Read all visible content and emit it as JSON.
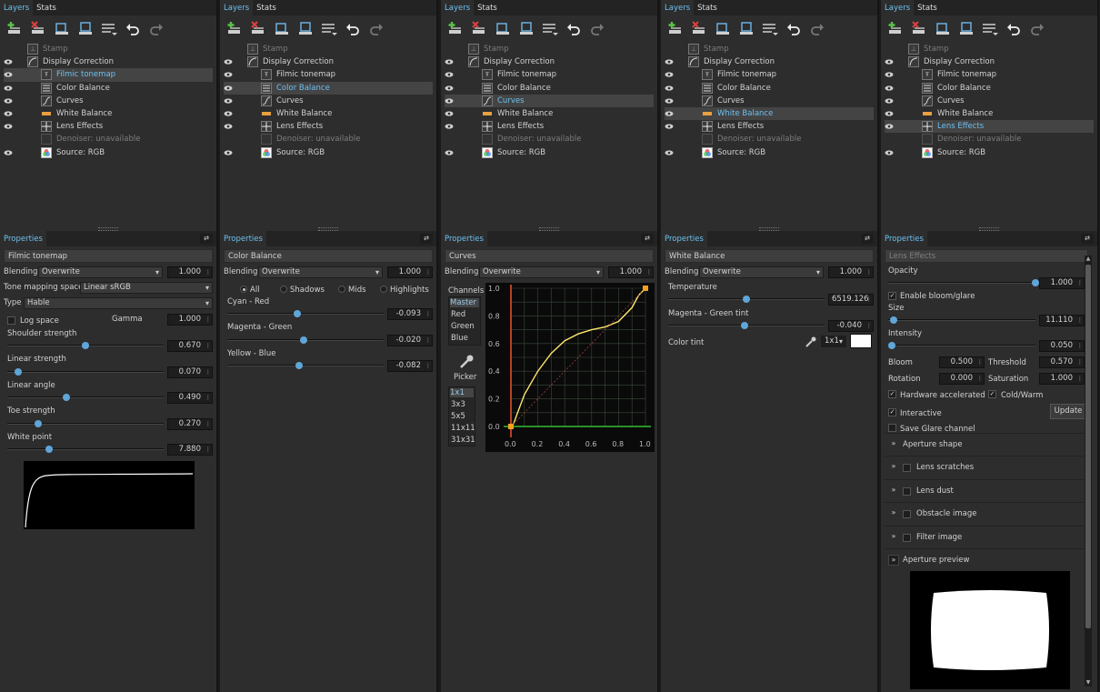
{
  "tabs": {
    "layers": "Layers",
    "stats": "Stats",
    "properties": "Properties"
  },
  "layers": {
    "stamp": "Stamp",
    "display_correction": "Display Correction",
    "filmic": "Filmic tonemap",
    "color_balance": "Color Balance",
    "curves": "Curves",
    "white_balance": "White Balance",
    "lens_effects": "Lens Effects",
    "denoiser": "Denoiser: unavailable",
    "source": "Source: RGB"
  },
  "common": {
    "blending_label": "Blending",
    "blending_value": "Overwrite",
    "opacity_value": "1.000"
  },
  "panel1": {
    "selected": "Filmic tonemap",
    "layer_name": "Filmic tonemap",
    "tone_mapping_label": "Tone mapping space",
    "tone_mapping_value": "Linear sRGB",
    "type_label": "Type",
    "type_value": "Hable",
    "log_space_label": "Log space",
    "gamma_label": "Gamma",
    "gamma_value": "1.000",
    "shoulder_label": "Shoulder strength",
    "shoulder_value": "0.670",
    "shoulder_level": 0.5,
    "linear_strength_label": "Linear strength",
    "linear_strength_value": "0.070",
    "linear_strength_level": 0.07,
    "linear_angle_label": "Linear angle",
    "linear_angle_value": "0.490",
    "linear_angle_level": 0.38,
    "toe_strength_label": "Toe strength",
    "toe_strength_value": "0.270",
    "toe_strength_level": 0.2,
    "white_point_label": "White point",
    "white_point_value": "7.880",
    "white_point_level": 0.27
  },
  "panel2": {
    "selected": "Color Balance",
    "layer_name": "Color Balance",
    "range_all": "All",
    "range_shadows": "Shadows",
    "range_mids": "Mids",
    "range_highlights": "Highlights",
    "cyan_red_label": "Cyan - Red",
    "cyan_red_value": "-0.093",
    "cyan_red_level": 0.45,
    "magenta_green_label": "Magenta - Green",
    "magenta_green_value": "-0.020",
    "magenta_green_level": 0.49,
    "yellow_blue_label": "Yellow - Blue",
    "yellow_blue_value": "-0.082",
    "yellow_blue_level": 0.46
  },
  "panel3": {
    "selected": "Curves",
    "layer_name": "Curves",
    "channels_label": "Channels",
    "channels": [
      "Master",
      "Red",
      "Green",
      "Blue"
    ],
    "picker_label": "Picker",
    "picker_sizes": [
      "1x1",
      "3x3",
      "5x5",
      "11x11",
      "31x31"
    ],
    "chart_data": {
      "type": "line",
      "x_ticks": [
        "0.0",
        "0.2",
        "0.4",
        "0.6",
        "0.8",
        "1.0"
      ],
      "y_ticks": [
        "0.0",
        "0.2",
        "0.4",
        "0.6",
        "0.8",
        "1.0"
      ],
      "xlim": [
        0,
        1
      ],
      "ylim": [
        0,
        1
      ],
      "grid": true,
      "series": [
        {
          "color": "#ffe66b",
          "x": [
            0.0,
            0.02,
            0.05,
            0.1,
            0.2,
            0.3,
            0.4,
            0.5,
            0.6,
            0.7,
            0.8,
            0.9,
            0.95,
            1.0
          ],
          "y": [
            0.0,
            0.02,
            0.1,
            0.23,
            0.4,
            0.53,
            0.62,
            0.67,
            0.7,
            0.72,
            0.76,
            0.86,
            0.95,
            1.0
          ]
        },
        {
          "color": "#a04040",
          "x": [
            0,
            1
          ],
          "y": [
            0,
            1
          ]
        }
      ]
    }
  },
  "panel4": {
    "selected": "White Balance",
    "layer_name": "White Balance",
    "temperature_label": "Temperature",
    "temperature_value": "6519.126",
    "temperature_level": 0.5,
    "tint_label": "Magenta - Green tint",
    "tint_value": "-0.040",
    "tint_level": 0.49,
    "color_tint_label": "Color tint",
    "color_tint_size": "1x1"
  },
  "panel5": {
    "selected": "Lens Effects",
    "layer_name": "Lens Effects",
    "opacity_label": "Opacity",
    "opacity_value": "1.000",
    "opacity_level": 1.0,
    "enable_bloom_label": "Enable bloom/glare",
    "size_label": "Size",
    "size_value": "11.110",
    "size_level": 0.0,
    "intensity_label": "Intensity",
    "intensity_value": "0.050",
    "intensity_level": 0.0,
    "bloom_label": "Bloom",
    "bloom_value": "0.500",
    "threshold_label": "Threshold",
    "threshold_value": "0.570",
    "rotation_label": "Rotation",
    "rotation_value": "0.000",
    "saturation_label": "Saturation",
    "saturation_value": "1.000",
    "hw_accel_label": "Hardware accelerated",
    "cold_warm_label": "Cold/Warm",
    "interactive_label": "Interactive",
    "update_label": "Update",
    "save_glare_label": "Save Glare channel",
    "aperture_shape": "Aperture shape",
    "lens_scratches": "Lens scratches",
    "lens_dust": "Lens dust",
    "obstacle_image": "Obstacle image",
    "filter_image": "Filter image",
    "aperture_preview": "Aperture preview"
  }
}
